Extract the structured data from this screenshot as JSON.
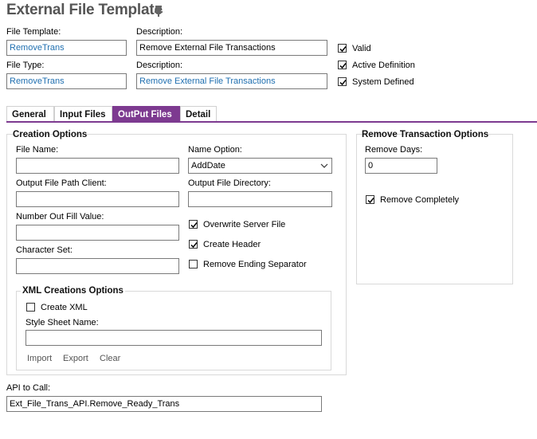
{
  "header": {
    "title": "External File Template",
    "pin_icon": "pin-icon"
  },
  "top_fields": {
    "file_template_label": "File Template:",
    "file_template_value": "RemoveTrans",
    "description1_label": "Description:",
    "description1_value": "Remove External File Transactions",
    "file_type_label": "File Type:",
    "file_type_value": "RemoveTrans",
    "description2_label": "Description:",
    "description2_value": "Remove External File Transactions"
  },
  "flags": {
    "valid": {
      "label": "Valid",
      "checked": true
    },
    "active_definition": {
      "label": "Active Definition",
      "checked": true
    },
    "system_defined": {
      "label": "System Defined",
      "checked": true
    }
  },
  "tabs": [
    {
      "label": "General",
      "active": false
    },
    {
      "label": "Input Files",
      "active": false
    },
    {
      "label": "OutPut Files",
      "active": true
    },
    {
      "label": "Detail",
      "active": false
    }
  ],
  "creation_options": {
    "title": "Creation Options",
    "file_name_label": "File Name:",
    "file_name_value": "",
    "name_option_label": "Name Option:",
    "name_option_value": "AddDate",
    "output_path_client_label": "Output File Path Client:",
    "output_path_client_value": "",
    "output_dir_label": "Output File Directory:",
    "output_dir_value": "",
    "number_fill_label": "Number Out Fill Value:",
    "number_fill_value": "",
    "character_set_label": "Character Set:",
    "character_set_value": "",
    "overwrite_server_file": {
      "label": "Overwrite Server File",
      "checked": true
    },
    "create_header": {
      "label": "Create Header",
      "checked": true
    },
    "remove_ending_separator": {
      "label": "Remove Ending Separator",
      "checked": false
    }
  },
  "xml_options": {
    "title": "XML Creations Options",
    "create_xml": {
      "label": "Create XML",
      "checked": false
    },
    "style_sheet_label": "Style Sheet Name:",
    "style_sheet_value": "",
    "import_label": "Import",
    "export_label": "Export",
    "clear_label": "Clear"
  },
  "remove_options": {
    "title": "Remove Transaction Options",
    "remove_days_label": "Remove Days:",
    "remove_days_value": "0",
    "remove_completely": {
      "label": "Remove Completely",
      "checked": true
    }
  },
  "api": {
    "label": "API to Call:",
    "value": "Ext_File_Trans_API.Remove_Ready_Trans"
  },
  "colors": {
    "accent": "#7d3a90",
    "link": "#1f6fb0"
  }
}
